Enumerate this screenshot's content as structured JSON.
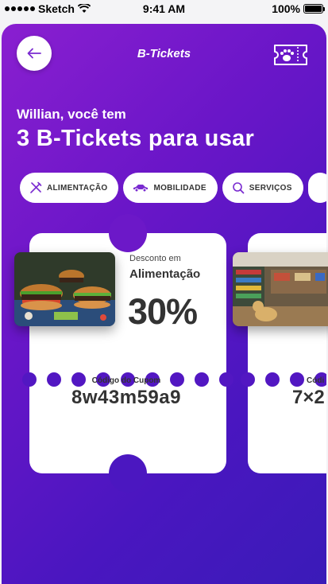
{
  "status_bar": {
    "carrier": "Sketch",
    "time": "9:41 AM",
    "battery": "100%"
  },
  "header": {
    "title": "B-Tickets",
    "back_icon": "arrow-left-icon",
    "ticket_icon": "ticket-paw-icon"
  },
  "greeting": "Willian, você tem",
  "headline": "3 B-Tickets para usar",
  "categories": [
    {
      "label": "ALIMENTAÇÃO",
      "icon": "fork-knife-icon"
    },
    {
      "label": "MOBILIDADE",
      "icon": "car-icon"
    },
    {
      "label": "SERVIÇOS",
      "icon": "search-service-icon"
    }
  ],
  "coupons": [
    {
      "desc_label": "Desconto em",
      "category": "Alimentação",
      "discount": "30%",
      "code_label": "Código do Cupom",
      "code": "8w43m59a9"
    },
    {
      "code_label": "Códi",
      "code": "7×2"
    }
  ],
  "colors": {
    "accent_start": "#8a1fd0",
    "accent_end": "#3a1bb8",
    "icon_purple": "#7a2bd0"
  }
}
